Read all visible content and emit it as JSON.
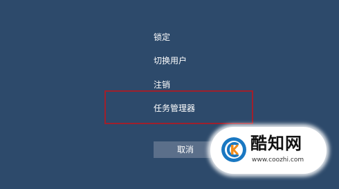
{
  "menu": {
    "items": [
      {
        "label": "锁定"
      },
      {
        "label": "切换用户"
      },
      {
        "label": "注销"
      },
      {
        "label": "任务管理器"
      }
    ],
    "cancel_label": "取消"
  },
  "colors": {
    "background": "#2d4a6b",
    "highlight_border": "#a0202c",
    "cancel_button": "#5b6f8a"
  },
  "watermark": {
    "brand": "酷知网",
    "url": "www.coozhi.com"
  }
}
